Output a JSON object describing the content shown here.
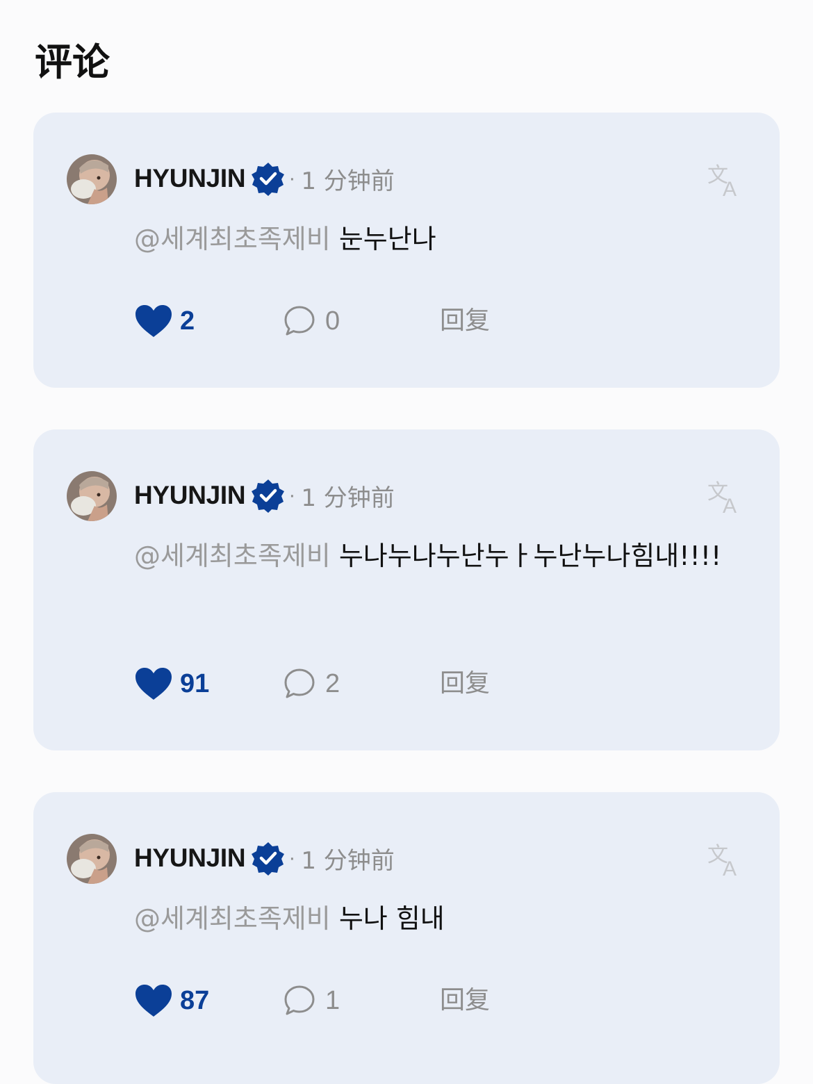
{
  "header": {
    "title": "评论"
  },
  "colors": {
    "card_bg": "#e9eef7",
    "accent": "#0b3f97",
    "muted": "#8d8d8d",
    "page_bg": "#fbfbfc"
  },
  "comments": [
    {
      "author": "HYUNJIN",
      "verified_icon": "verified-badge-icon",
      "separator": "·",
      "time": "1 分钟前",
      "mention": "@세계최초족제비",
      "text": "눈누난나",
      "likes": "2",
      "replies": "0",
      "reply_label": "回复",
      "translate_icon": "translate-icon"
    },
    {
      "author": "HYUNJIN",
      "verified_icon": "verified-badge-icon",
      "separator": "·",
      "time": "1 分钟前",
      "mention": "@세계최초족제비",
      "text": "누나누나누난누ㅏ누난누나힘내!!!!",
      "likes": "91",
      "replies": "2",
      "reply_label": "回复",
      "translate_icon": "translate-icon"
    },
    {
      "author": "HYUNJIN",
      "verified_icon": "verified-badge-icon",
      "separator": "·",
      "time": "1 分钟前",
      "mention": "@세계최초족제비",
      "text": "누나 힘내",
      "likes": "87",
      "replies": "1",
      "reply_label": "回复",
      "translate_icon": "translate-icon"
    }
  ]
}
